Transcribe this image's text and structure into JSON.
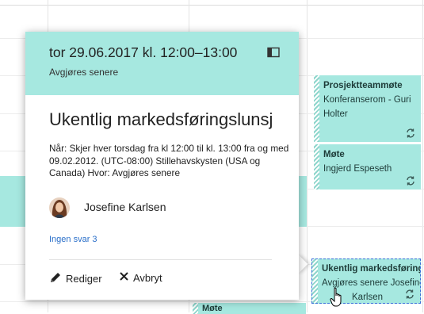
{
  "popup": {
    "date_time": "tor 29.06.2017 kl. 12:00–13:00",
    "location": "Avgjøres senere",
    "expand_icon": "expand-icon",
    "title": "Ukentlig markedsføringslunsj",
    "details": "Når: Skjer hver torsdag fra kl 12:00 til kl. 13:00 fra og med 09.02.2012. (UTC-08:00) Stillehavskysten (USA og Canada) Hvor: Avgjøres senere",
    "organizer": "Josefine Karlsen",
    "responses_link": "Ingen svar 3",
    "edit_label": "Rediger",
    "cancel_label": "Avbryt"
  },
  "events": [
    {
      "title": "Prosjektteammøte",
      "lines": [
        "Konferanserom - Guri",
        "Holter"
      ],
      "recurring_icon": "recurring-icon"
    },
    {
      "title": "Møte",
      "lines": [
        "Ingjerd Espeseth"
      ],
      "recurring_icon": "recurring-icon"
    },
    {
      "title": "Ukentlig markedsføringsl.",
      "lines": [
        "Avgjøres senere Josefine",
        "Karlsen"
      ],
      "recurring_icon": "recurring-icon"
    },
    {
      "title": "Møte",
      "lines": []
    }
  ],
  "colors": {
    "event_teal": "#a6e8e0",
    "link_blue": "#2a6fc9",
    "selection_border": "#3a6fd9"
  }
}
